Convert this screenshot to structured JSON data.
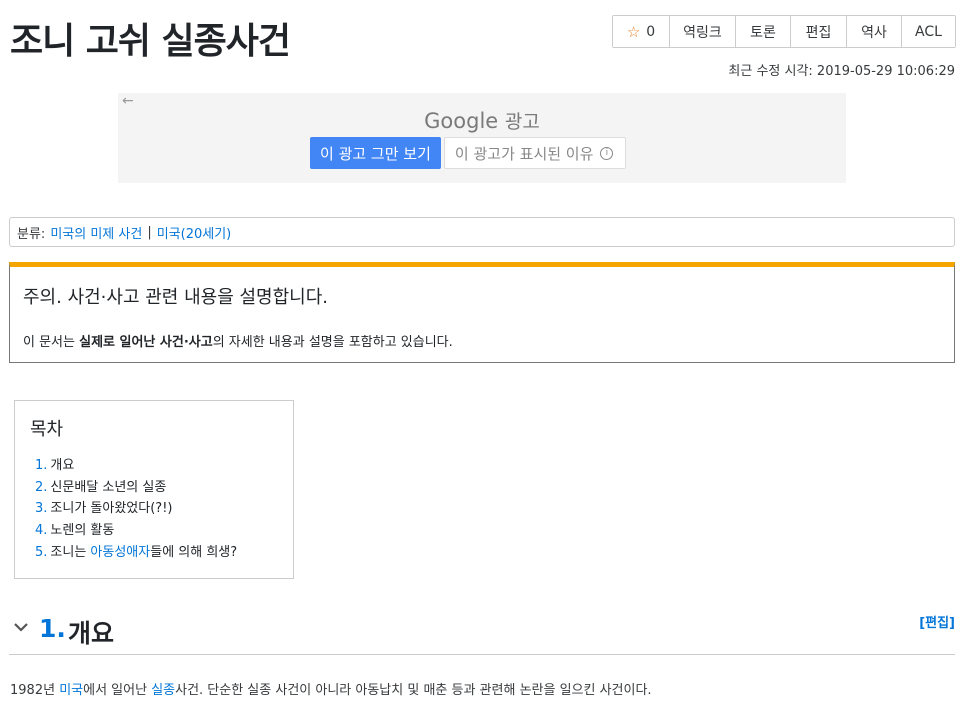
{
  "page": {
    "title": "조니 고쉬 실종사건",
    "last_modified": "최근 수정 시각: 2019-05-29 10:06:29"
  },
  "toolbar": {
    "star_count": "0",
    "backlink": "역링크",
    "discuss": "토론",
    "edit": "편집",
    "history": "역사",
    "acl": "ACL"
  },
  "ad": {
    "brand": "Google",
    "label": "광고",
    "stop_button": "이 광고 그만 보기",
    "why_button": "이 광고가 표시된 이유"
  },
  "category": {
    "prefix": "분류:",
    "items": [
      "미국의 미제 사건",
      "미국(20세기)"
    ],
    "separator": "|"
  },
  "notice": {
    "title": "주의. 사건·사고 관련 내용을 설명합니다.",
    "body_before": "이 문서는 ",
    "body_bold": "실제로 일어난 사건·사고",
    "body_after": "의 자세한 내용과 설명을 포함하고 있습니다."
  },
  "toc": {
    "title": "목차",
    "items": [
      {
        "num": "1.",
        "text": "개요"
      },
      {
        "num": "2.",
        "text": "신문배달 소년의 실종"
      },
      {
        "num": "3.",
        "text": "조니가 돌아왔었다(?!)"
      },
      {
        "num": "4.",
        "text": "노렌의 활동"
      },
      {
        "num": "5.",
        "text": "조니는 ",
        "link": "아동성애자",
        "after": "들에 의해 희생?"
      }
    ]
  },
  "section": {
    "num": "1.",
    "title": "개요",
    "edit": "[편집]"
  },
  "paragraph": {
    "part1": "1982년 ",
    "link1": "미국",
    "part2": "에서 일어난 ",
    "link2": "실종",
    "part3": "사건. 단순한 실종 사건이 아니라 아동납치 및 매춘 등과 관련해 논란을 일으킨 사건이다."
  },
  "colors": {
    "link": "#0275d8",
    "notice_accent": "#f5a500",
    "ad_button": "#4285f4",
    "star": "#e67e22"
  }
}
